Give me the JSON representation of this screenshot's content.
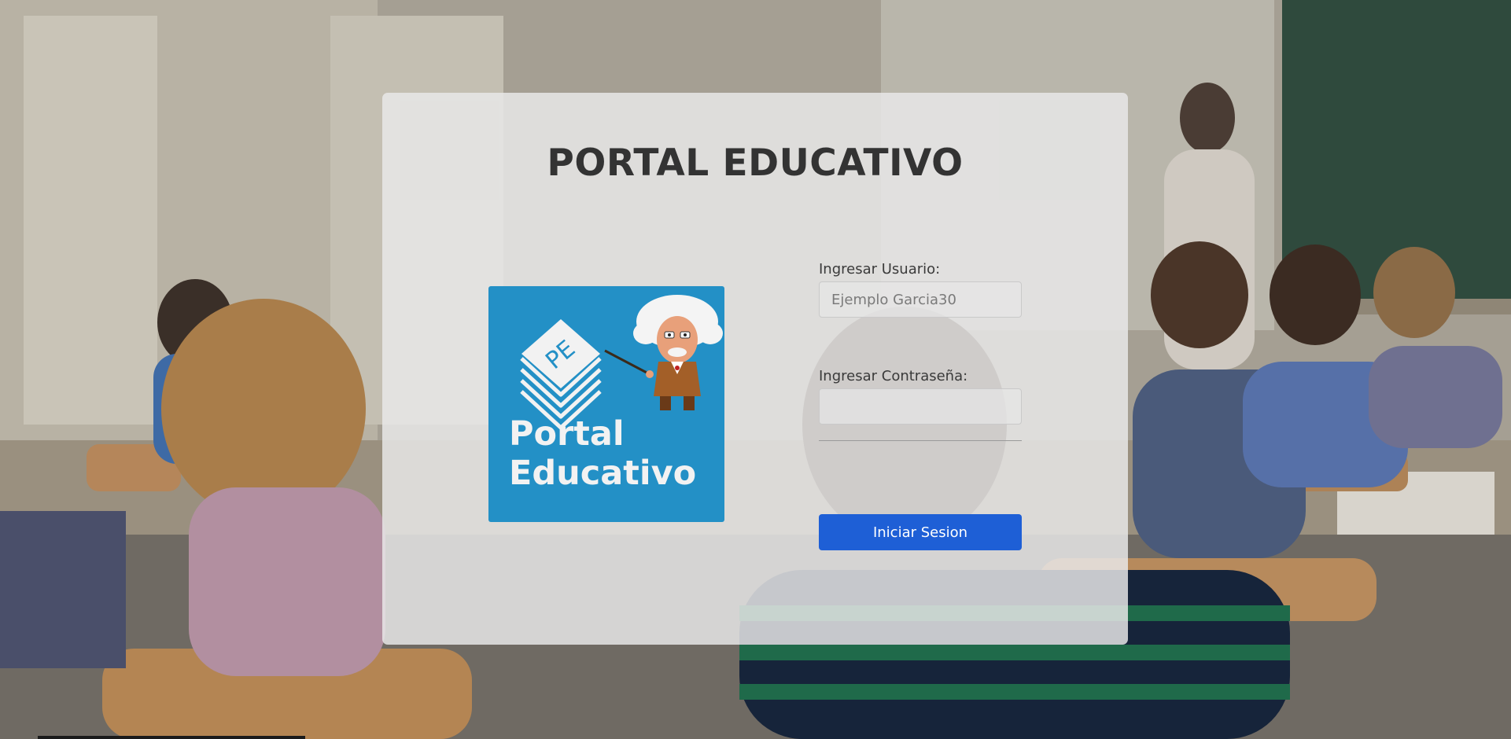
{
  "page": {
    "title": "PORTAL EDUCATIVO"
  },
  "logo": {
    "badge": "PE",
    "line1": "Portal",
    "line2": "Educativo"
  },
  "form": {
    "username_label": "Ingresar Usuario:",
    "username_placeholder": "Ejemplo Garcia30",
    "username_value": "",
    "password_label": "Ingresar Contraseña:",
    "password_value": "",
    "submit_label": "Iniciar Sesion"
  },
  "colors": {
    "logo_background": "#2390c6",
    "button_background": "#1e5fd6",
    "card_background": "#e8e8e8",
    "title_text": "#333333"
  },
  "icons": {
    "logo_badge": "stacked-paper-icon",
    "logo_mascot": "professor-mascot-icon"
  }
}
